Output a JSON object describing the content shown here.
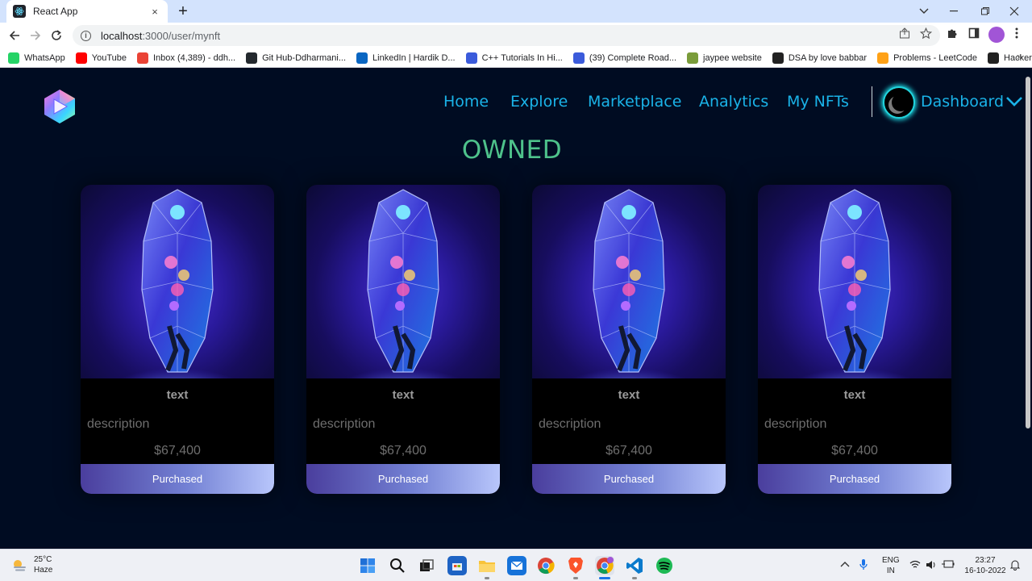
{
  "browser": {
    "tab_title": "React App",
    "tab_close": "×",
    "new_tab": "+",
    "url_host": "localhost",
    "url_path": ":3000/user/mynft",
    "bookmarks": [
      {
        "label": "WhatsApp",
        "color": "#25d366"
      },
      {
        "label": "YouTube",
        "color": "#ff0000"
      },
      {
        "label": "Inbox (4,389) - ddh...",
        "color": "#ea4335"
      },
      {
        "label": "Git Hub-Ddharmani...",
        "color": "#24292e"
      },
      {
        "label": "LinkedIn | Hardik D...",
        "color": "#0a66c2"
      },
      {
        "label": "C++ Tutorials In Hi...",
        "color": "#3b5bdb"
      },
      {
        "label": "(39) Complete Road...",
        "color": "#3b5bdb"
      },
      {
        "label": "jaypee website",
        "color": "#7a9c3a"
      },
      {
        "label": "DSA by love babbar",
        "color": "#222222"
      },
      {
        "label": "Problems - LeetCode",
        "color": "#ffa116"
      },
      {
        "label": "HackerRank",
        "color": "#222222"
      }
    ]
  },
  "nav": {
    "items": [
      "Home",
      "Explore",
      "Marketplace",
      "Analytics",
      "My NFTs"
    ],
    "dashboard": "Dashboard"
  },
  "heading": "OWNED",
  "cards": [
    {
      "name": "text",
      "description": "description",
      "price": "$67,400",
      "button": "Purchased"
    },
    {
      "name": "text",
      "description": "description",
      "price": "$67,400",
      "button": "Purchased"
    },
    {
      "name": "text",
      "description": "description",
      "price": "$67,400",
      "button": "Purchased"
    },
    {
      "name": "text",
      "description": "description",
      "price": "$67,400",
      "button": "Purchased"
    }
  ],
  "taskbar": {
    "temperature": "25°C",
    "condition": "Haze",
    "lang_line1": "ENG",
    "lang_line2": "IN",
    "time": "23:27",
    "date": "16-10-2022"
  },
  "colors": {
    "page_bg": "#000c22",
    "nav_link": "#1ab3e8",
    "heading": "#4ec28b"
  }
}
